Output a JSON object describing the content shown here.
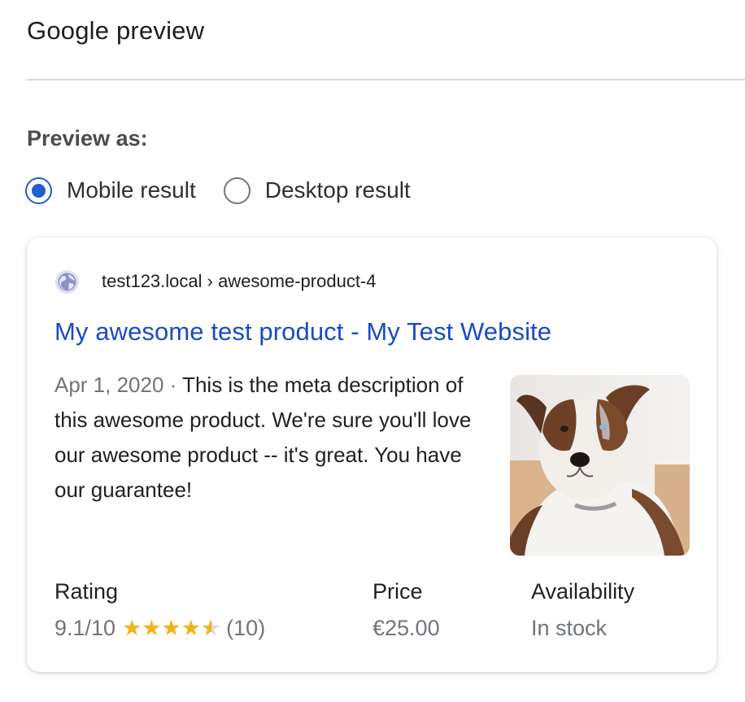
{
  "section": {
    "title": "Google preview"
  },
  "preview": {
    "label": "Preview as:",
    "options": [
      {
        "label": "Mobile result",
        "selected": true
      },
      {
        "label": "Desktop result",
        "selected": false
      }
    ]
  },
  "result": {
    "icon": "globe-icon",
    "breadcrumb": "test123.local › awesome-product-4",
    "title": "My awesome test product - My Test Website",
    "date": "Apr 1, 2020",
    "separator": " · ",
    "description": "This is the meta description of this awesome product. We're sure you'll love our awesome product -- it's great. You have our guarantee!",
    "thumbnail_alt": "dog-thumbnail"
  },
  "rich_results": {
    "rating": {
      "heading": "Rating",
      "value": "9.1/10",
      "stars_filled": 4.55,
      "stars_total": 5,
      "count": "(10)"
    },
    "price": {
      "heading": "Price",
      "value": "€25.00"
    },
    "availability": {
      "heading": "Availability",
      "value": "In stock"
    }
  },
  "colors": {
    "link": "#1a4bc4",
    "radio_selected": "#1f5fd0",
    "star": "#f3b31c"
  }
}
